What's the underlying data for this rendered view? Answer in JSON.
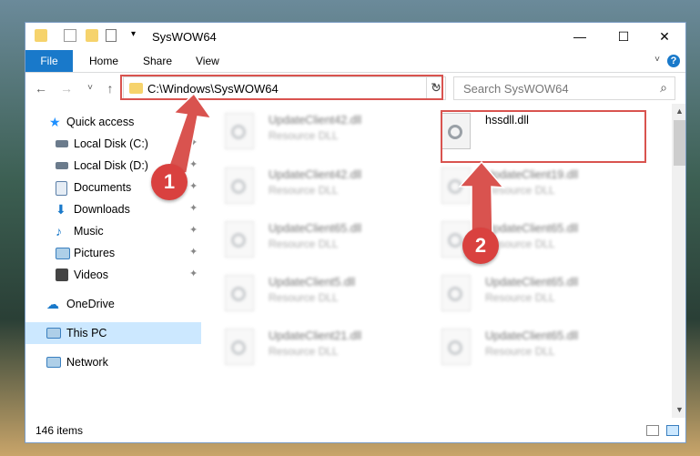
{
  "window": {
    "title": "SysWOW64",
    "min_symbol": "—",
    "max_symbol": "☐",
    "close_symbol": "✕"
  },
  "ribbon": {
    "tabs": [
      "File",
      "Home",
      "Share",
      "View"
    ],
    "help": "?"
  },
  "nav": {
    "back": "←",
    "forward": "→",
    "recent": "˅",
    "up": "↑",
    "address_path": "C:\\Windows\\SysWOW64",
    "refresh": "↻",
    "search_placeholder": "Search SysWOW64",
    "search_icon": "⌕"
  },
  "sidebar": {
    "items": [
      {
        "label": "Quick access",
        "icon": "star-icon",
        "color": "#1e90ff",
        "pinned": false
      },
      {
        "label": "Local Disk (C:)",
        "icon": "drive-icon",
        "color": "#6b7b8c",
        "pinned": true
      },
      {
        "label": "Local Disk (D:)",
        "icon": "drive-icon",
        "color": "#6b7b8c",
        "pinned": true
      },
      {
        "label": "Documents",
        "icon": "documents-icon",
        "color": "#5b7fa8",
        "pinned": true
      },
      {
        "label": "Downloads",
        "icon": "downloads-icon",
        "color": "#1979ca",
        "pinned": true
      },
      {
        "label": "Music",
        "icon": "music-icon",
        "color": "#1979ca",
        "pinned": true
      },
      {
        "label": "Pictures",
        "icon": "pictures-icon",
        "color": "#3a7fbf",
        "pinned": true
      },
      {
        "label": "Videos",
        "icon": "videos-icon",
        "color": "#555555",
        "pinned": true
      },
      {
        "label": "OneDrive",
        "icon": "onedrive-icon",
        "color": "#1979ca",
        "pinned": false
      },
      {
        "label": "This PC",
        "icon": "pc-icon",
        "color": "#3a7fbf",
        "pinned": false,
        "selected": true
      },
      {
        "label": "Network",
        "icon": "network-icon",
        "color": "#3a7fbf",
        "pinned": false
      }
    ],
    "pin_symbol": "📌"
  },
  "files": [
    {
      "name": "UpdateClient42.dll",
      "type": "Resource DLL",
      "blurred": true
    },
    {
      "name": "hssdll.dll",
      "type": "",
      "blurred": false
    },
    {
      "name": "UpdateClient42.dll",
      "type": "Resource DLL",
      "blurred": true
    },
    {
      "name": "UpdateClient19.dll",
      "type": "Resource DLL",
      "blurred": true
    },
    {
      "name": "UpdateClient65.dll",
      "type": "Resource DLL",
      "blurred": true
    },
    {
      "name": "UpdateClient65.dll",
      "type": "Resource DLL",
      "blurred": true
    },
    {
      "name": "UpdateClient5.dll",
      "type": "Resource DLL",
      "blurred": true
    },
    {
      "name": "UpdateClient65.dll",
      "type": "Resource DLL",
      "blurred": true
    },
    {
      "name": "UpdateClient21.dll",
      "type": "Resource DLL",
      "blurred": true
    },
    {
      "name": "UpdateClient65.dll",
      "type": "Resource DLL",
      "blurred": true
    }
  ],
  "status": {
    "item_count": "146 items"
  },
  "annotations": {
    "marker1": "1",
    "marker2": "2",
    "color": "#d9534f"
  }
}
